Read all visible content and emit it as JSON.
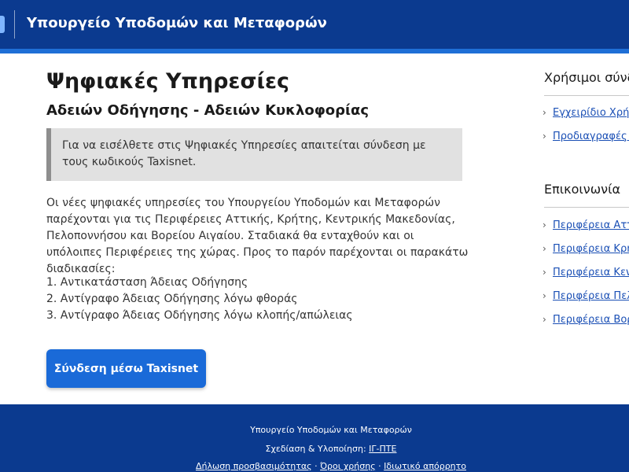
{
  "header": {
    "title": "Υπουργείο Υποδομών και Μεταφορών"
  },
  "main": {
    "title": "Ψηφιακές Υπηρεσίες",
    "subtitle": "Αδειών Οδήγησης - Αδειών Κυκλοφορίας",
    "notice": "Για να εισέλθετε στις Ψηφιακές Υπηρεσίες απαιτείται σύνδεση με τους κωδικούς Taxisnet.",
    "intro": "Οι νέες ψηφιακές υπηρεσίες του Υπουργείου Υποδομών και Μεταφορών παρέχονται για τις Περιφέρειες Αττικής, Κρήτης, Κεντρικής Μακεδονίας, Πελοποννήσου και Βορείου Αιγαίου. Σταδιακά θα ενταχθούν και οι υπόλοιπες Περιφέρειες της χώρας. Προς το παρόν παρέχονται οι παρακάτω διαδικασίες:",
    "procedures": [
      "1. Αντικατάσταση Άδειας Οδήγησης",
      "2. Αντίγραφο Άδειας Οδήγησης λόγω φθοράς",
      "3. Αντίγραφο Άδειας Οδήγησης λόγω κλοπής/απώλειας"
    ],
    "login_button": "Σύνδεση μέσω Taxisnet"
  },
  "sidebar": {
    "useful_heading": "Χρήσιμοι σύνδ",
    "useful_links": [
      "Εγχειρίδιο Χρήσ",
      "Προδιαγραφές Φ"
    ],
    "contact_heading": "Επικοινωνία",
    "contact_links": [
      "Περιφέρεια Αττι",
      "Περιφέρεια Κρήτ",
      "Περιφέρεια Κεντ",
      "Περιφέρεια Πελ",
      "Περιφέρεια Βορ"
    ]
  },
  "footer": {
    "ministry": "Υπουργείο Υποδομών και Μεταφορών",
    "design_label": "Σχεδίαση & Υλοποίηση:",
    "design_link": "ΙΓ-ΠΤΕ",
    "accessibility": "Δήλωση προσβασιμότητας",
    "separator": "·",
    "terms": "Όροι χρήσης",
    "privacy": "Ιδιωτικό απόρρητο"
  },
  "colors": {
    "header_bg": "#0b3a8f",
    "accent_stripe": "#1f6fd6",
    "button": "#1a6ad8",
    "link": "#1a4fb5",
    "notice_bg": "#e1e1e1",
    "footer_bg": "#0b3a8f"
  }
}
